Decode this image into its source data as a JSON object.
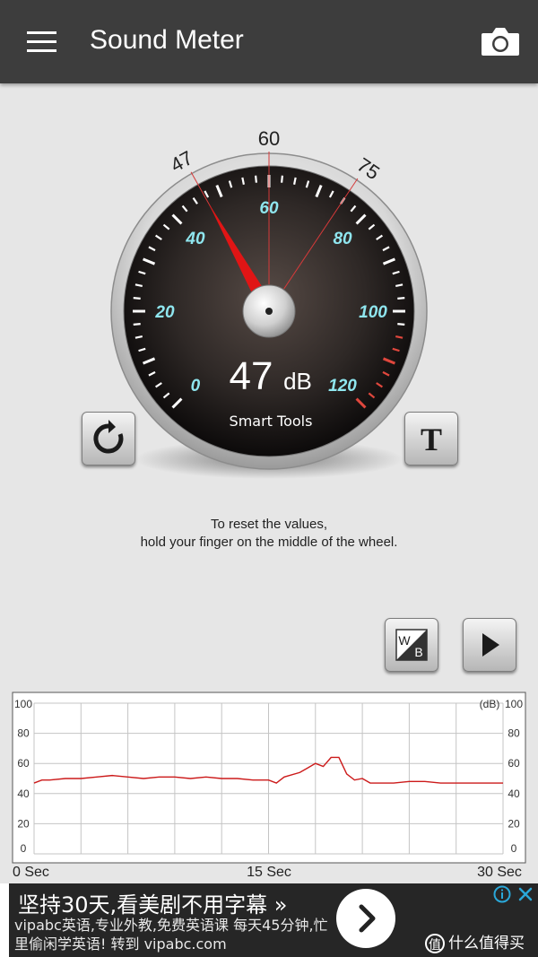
{
  "app": {
    "title": "Sound Meter",
    "menu_icon": "hamburger-menu-icon",
    "camera_icon": "camera-icon"
  },
  "gauge": {
    "reading_value": "47",
    "reading_unit": "dB",
    "brand": "Smart Tools",
    "current_db": 47,
    "min_marker": "47",
    "avg_marker": "60",
    "max_marker": "75",
    "scale_labels": [
      "0",
      "20",
      "40",
      "60",
      "80",
      "100",
      "120"
    ],
    "scale_min": 0,
    "scale_max": 120
  },
  "buttons": {
    "reset_icon": "rotate-refresh-icon",
    "text_label": "T",
    "wb_top": "W",
    "wb_bottom": "B",
    "play_icon": "play-icon"
  },
  "hint": {
    "line1": "To reset the values,",
    "line2": "hold your finger on the middle of the wheel."
  },
  "chart_data": {
    "type": "line",
    "unit_label": "(dB)",
    "y_ticks_left": [
      "100",
      "80",
      "60",
      "40",
      "20",
      "0"
    ],
    "y_ticks_right": [
      "100",
      "80",
      "60",
      "40",
      "20",
      "0"
    ],
    "x_labels": [
      "0 Sec",
      "15 Sec",
      "30 Sec"
    ],
    "xlim": [
      0,
      30
    ],
    "ylim": [
      0,
      100
    ],
    "grid": true,
    "series": [
      {
        "x": [
          0,
          0.5,
          1,
          2,
          3,
          4,
          5,
          6,
          7,
          8,
          9,
          10,
          11,
          12,
          13,
          14,
          15,
          15.5,
          16,
          17,
          17.5,
          18,
          18.5,
          19,
          19.5,
          20,
          20.5,
          21,
          21.5,
          22,
          23,
          24,
          25,
          26,
          27,
          28,
          29,
          30
        ],
        "y": [
          47,
          49,
          49,
          50,
          50,
          51,
          52,
          51,
          50,
          51,
          51,
          50,
          51,
          50,
          50,
          49,
          49,
          47,
          51,
          54,
          57,
          60,
          58,
          64,
          64,
          53,
          49,
          50,
          47,
          47,
          47,
          48,
          48,
          47,
          47,
          47,
          47,
          47
        ]
      }
    ]
  },
  "ad": {
    "headline": "坚持30天,看美剧不用字幕 »",
    "body": "vipabc英语,专业外教,免费英语课 每天45分钟,忙里偷闲学英语! 转到 vipabc.com",
    "info_icon": "ad-info-icon",
    "close_icon": "ad-close-icon",
    "arrow_icon": "chevron-right-icon"
  },
  "watermark": {
    "badge": "值",
    "text": "什么值得买"
  },
  "colors": {
    "appbar": "#3d3d3d",
    "needle": "#e01515",
    "scale_label": "#8fe6ef",
    "graph_line": "#cc1a1a"
  }
}
